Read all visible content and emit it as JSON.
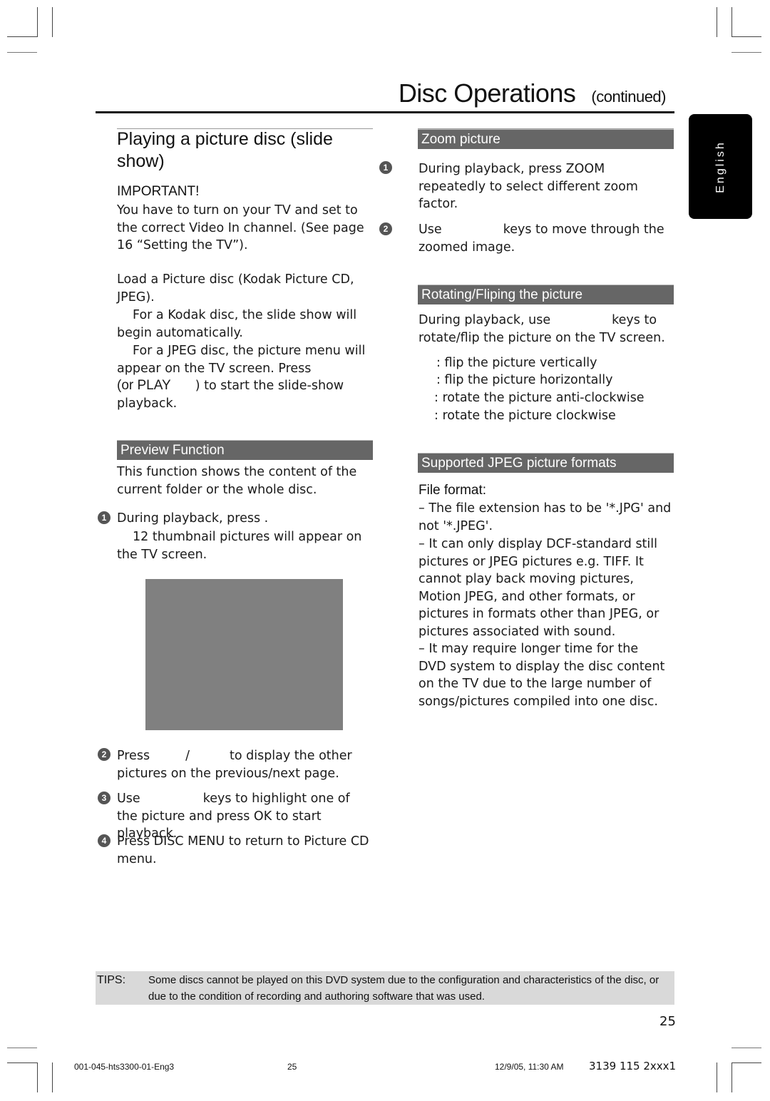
{
  "header": {
    "title": "Disc Operations",
    "continued": "(continued)"
  },
  "language_tab": "English",
  "left_column": {
    "heading": "Playing a picture disc (slide show)",
    "important_label": "IMPORTANT!",
    "important_text": "You have to turn on your TV and set to the correct Video In channel.  (See page 16 “Setting the TV”).",
    "load_text": "Load a Picture disc (Kodak Picture CD, JPEG).",
    "kodak_text": "For a Kodak disc, the slide show will begin automatically.",
    "jpeg_text_1": "For a JPEG disc, the picture menu will appear on the TV screen.  Press",
    "jpeg_text_2_pre": "(or PLAY",
    "jpeg_text_2_post": ") to start the slide-show playback.",
    "preview_section": {
      "title": "Preview Function",
      "intro": "This function shows the content of the current folder or the whole disc.",
      "steps": [
        {
          "num": "1",
          "text": "During playback, press      .",
          "sub": "12 thumbnail pictures will appear on the TV screen."
        },
        {
          "num": "2",
          "text_pre": "Press",
          "text_sep": "/",
          "text_post": "to display the other pictures on the previous/next page."
        },
        {
          "num": "3",
          "text_pre": "Use",
          "text_post": "keys to highlight one of the picture and press OK  to start playback."
        },
        {
          "num": "4",
          "text": "Press DISC MENU  to return to Picture CD menu."
        }
      ],
      "preview_placeholder_color": "#808080"
    }
  },
  "right_column": {
    "zoom_section": {
      "title": "Zoom picture",
      "steps": [
        {
          "num": "1",
          "text": "During playback, press ZOOM repeatedly to select different zoom factor."
        },
        {
          "num": "2",
          "text_pre": "Use",
          "text_post": "keys to move through the zoomed image."
        }
      ]
    },
    "rotate_section": {
      "title": "Rotating/Fliping the picture",
      "intro_pre": "During playback, use",
      "intro_post": "keys to rotate/flip the picture on the TV screen.",
      "items": [
        ": flip the picture vertically",
        ": flip the picture horizontally",
        ": rotate the picture anti-clockwise",
        ": rotate the picture clockwise"
      ]
    },
    "jpeg_section": {
      "title": "Supported JPEG picture formats",
      "file_format_label": "File format:",
      "items": [
        "–  The file extension has to be '*.JPG' and not '*.JPEG'.",
        "–  It can only display DCF-standard still pictures or JPEG pictures e.g. TIFF.  It cannot play back moving pictures, Motion JPEG, and other formats, or pictures in formats other than JPEG, or pictures associated with sound.",
        "–  It may require longer time for the DVD system to display the disc content on the TV due to the large number of songs/pictures compiled into one disc."
      ]
    }
  },
  "tips": {
    "label": "TIPS:",
    "text": "Some discs cannot be played on this DVD system due to the configuration and characteristics of the disc, or due to the condition of recording and authoring software that was used."
  },
  "page_number": "25",
  "footer": {
    "file": "001-045-hts3300-01-Eng3",
    "page": "25",
    "date": "12/9/05, 11:30 AM",
    "code": "3139 115 2xxx1"
  },
  "colors": {
    "section_bar": "#666666",
    "tips_bg": "#d9d9d9",
    "language_tab_bg": "#000000"
  }
}
